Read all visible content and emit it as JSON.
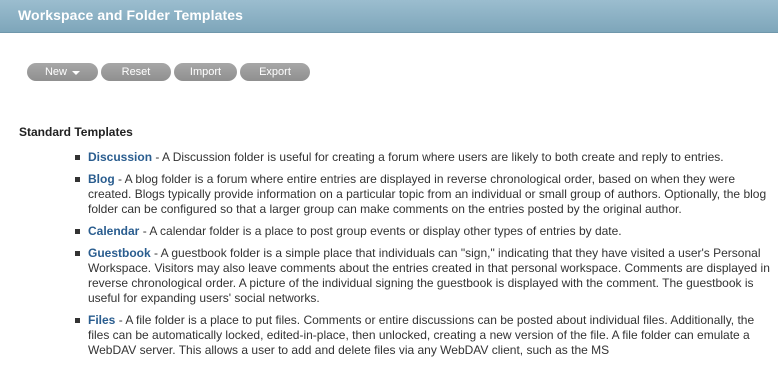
{
  "header": {
    "title": "Workspace and Folder Templates"
  },
  "toolbar": {
    "new_label": "New",
    "reset_label": "Reset",
    "import_label": "Import",
    "export_label": "Export"
  },
  "section": {
    "heading": "Standard Templates"
  },
  "templates": [
    {
      "name": "Discussion",
      "description": " - A Discussion folder is useful for creating a forum where users are likely to both create and reply to entries."
    },
    {
      "name": "Blog",
      "description": " - A blog folder is a forum where entire entries are displayed in reverse chronological order, based on when they were created. Blogs typically provide information on a particular topic from an individual or small group of authors. Optionally, the blog folder can be configured so that a larger group can make comments on the entries posted by the original author."
    },
    {
      "name": "Calendar",
      "description": " - A calendar folder is a place to post group events or display other types of entries by date."
    },
    {
      "name": "Guestbook",
      "description": " - A guestbook folder is a simple place that individuals can \"sign,\" indicating that they have visited a user's Personal Workspace. Visitors may also leave comments about the entries created in that personal workspace. Comments are displayed in reverse chronological order. A picture of the individual signing the guestbook is displayed with the comment. The guestbook is useful for expanding users' social networks."
    },
    {
      "name": "Files",
      "description": " - A file folder is a place to put files. Comments or entire discussions can be posted about individual files. Additionally, the files can be automatically locked, edited-in-place, then unlocked, creating a new version of the file. A file folder can emulate a WebDAV server. This allows a user to add and delete files via any WebDAV client, such as the MS"
    }
  ]
}
